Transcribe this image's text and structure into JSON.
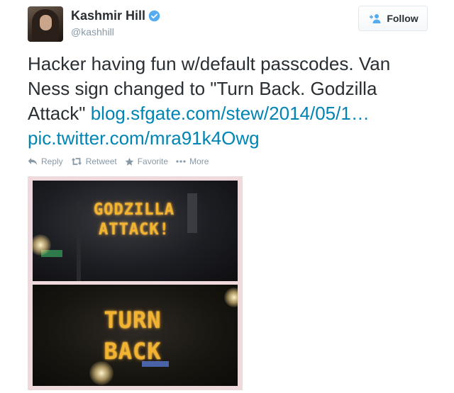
{
  "user": {
    "name": "Kashmir Hill",
    "handle": "@kashhill",
    "verified": true,
    "verified_color": "#55acee"
  },
  "follow_button": {
    "label": "Follow",
    "icon": "add-person-icon"
  },
  "tweet": {
    "text": "Hacker having fun w/default passcodes. Van Ness sign changed to \"Turn Back. Godzilla Attack\" ",
    "link": "blog.sfgate.com/stew/2014/05/1…",
    "pic_link": "pic.twitter.com/mra91k4Owg",
    "link_color": "#0084b4"
  },
  "actions": [
    {
      "label": "Reply",
      "icon": "reply-icon"
    },
    {
      "label": "Retweet",
      "icon": "retweet-icon"
    },
    {
      "label": "Favorite",
      "icon": "star-icon"
    },
    {
      "label": "More",
      "icon": "more-dots-icon"
    }
  ],
  "photo": {
    "top_sign": [
      "GODZILLA",
      "ATTACK!"
    ],
    "bottom_sign": [
      "TURN",
      "BACK"
    ]
  }
}
